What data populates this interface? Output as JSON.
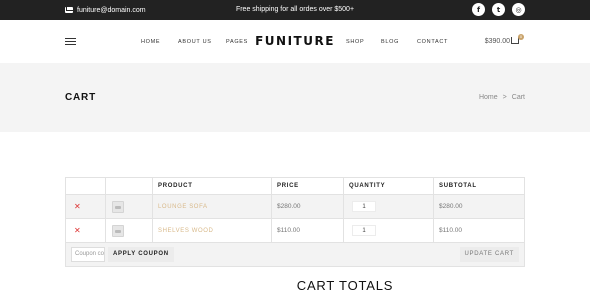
{
  "topbar": {
    "email": "funiture@domain.com",
    "shipping": "Free shipping for all ordes over $500+",
    "socials": [
      {
        "icon": "facebook-icon",
        "glyph": "f"
      },
      {
        "icon": "twitter-icon",
        "glyph": "t"
      },
      {
        "icon": "instagram-icon",
        "glyph": "◎"
      }
    ]
  },
  "header": {
    "logo": "FUNITURE",
    "nav_left": [
      "HOME",
      "ABOUT US",
      "PAGES"
    ],
    "nav_right": [
      "SHOP",
      "BLOG",
      "CONTACT"
    ],
    "cart_total": "$390.00",
    "cart_count": "0",
    "accent": "#c9a36b"
  },
  "band": {
    "title": "CART",
    "breadcrumb": [
      "Home",
      "Cart"
    ],
    "separator": ">"
  },
  "table": {
    "headers": [
      "PRODUCT",
      "PRICE",
      "QUANTITY",
      "SUBTOTAL"
    ],
    "rows": [
      {
        "name": "LOUNGE SOFA",
        "price": "$280.00",
        "qty": "1",
        "subtotal": "$280.00"
      },
      {
        "name": "SHELVES WOOD",
        "price": "$110.00",
        "qty": "1",
        "subtotal": "$110.00"
      }
    ],
    "coupon_placeholder": "Coupon code",
    "apply_label": "APPLY COUPON",
    "update_label": "UPDATE CART"
  },
  "totals": {
    "title": "CART TOTALS"
  }
}
